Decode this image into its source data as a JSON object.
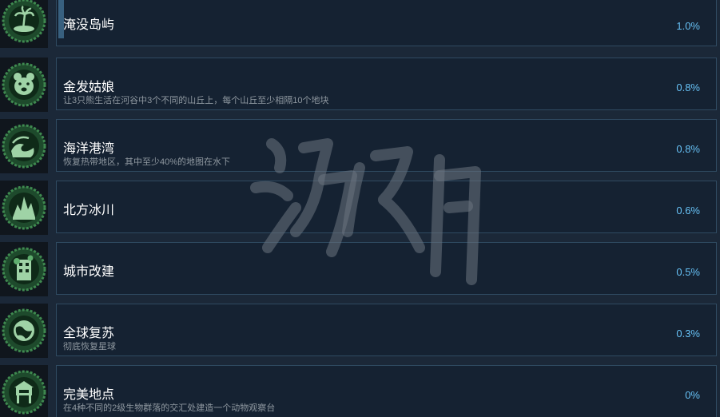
{
  "achievements": [
    {
      "title": "淹没岛屿",
      "description": "",
      "percent": "1.0%",
      "icon": "palm-island-icon"
    },
    {
      "title": "金发姑娘",
      "description": "让3只熊生活在河谷中3个不同的山丘上，每个山丘至少相隔10个地块",
      "percent": "0.8%",
      "icon": "bear-face-icon"
    },
    {
      "title": "海洋港湾",
      "description": "恢复热带地区，其中至少40%的地图在水下",
      "percent": "0.8%",
      "icon": "ocean-wave-icon"
    },
    {
      "title": "北方冰川",
      "description": "",
      "percent": "0.6%",
      "icon": "glacier-trees-icon"
    },
    {
      "title": "城市改建",
      "description": "",
      "percent": "0.5%",
      "icon": "overgrown-building-icon"
    },
    {
      "title": "全球复苏",
      "description": "彻底恢复星球",
      "percent": "0.3%",
      "icon": "globe-icon"
    },
    {
      "title": "完美地点",
      "description": "在4种不同的2级生物群落的交汇处建造一个动物观察台",
      "percent": "0%",
      "icon": "observation-deck-icon"
    }
  ],
  "watermark": {
    "text": "游侠网"
  },
  "colors": {
    "background": "#1b2838",
    "card": "#152232",
    "card_border": "#2f4a61",
    "percent": "#66c0f4",
    "icon_green": "#2e6b3f"
  }
}
